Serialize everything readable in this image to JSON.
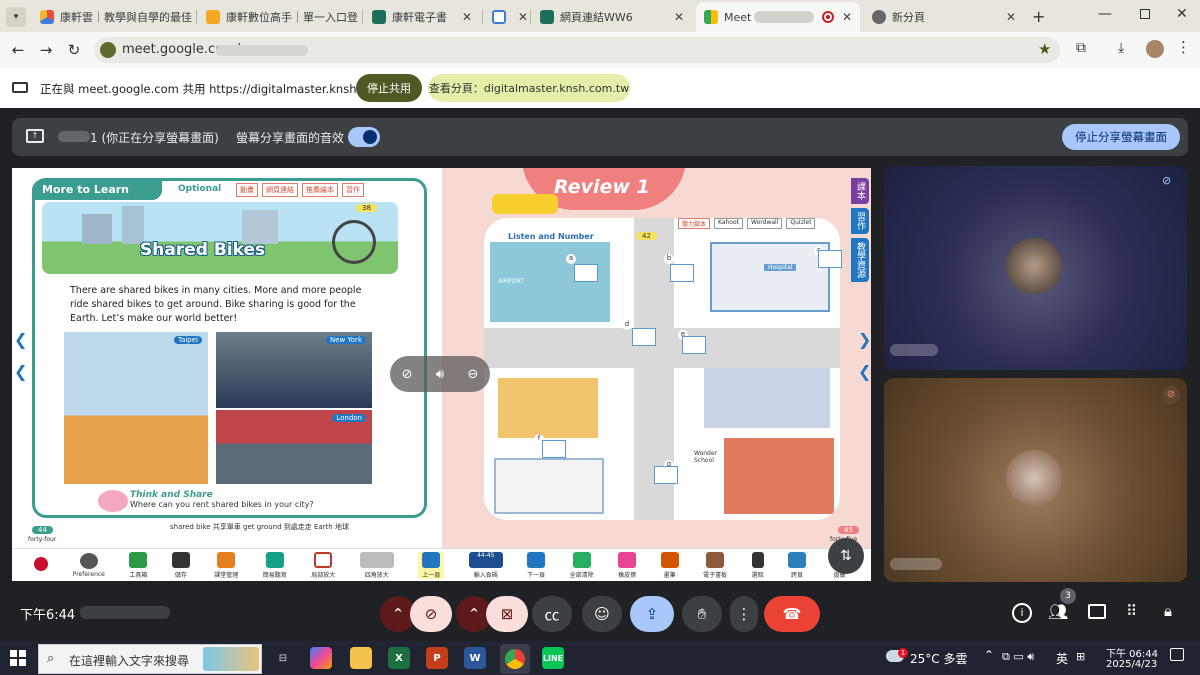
{
  "browser": {
    "tabs": [
      {
        "label": "康軒雲｜教學與自學的最佳"
      },
      {
        "label": "康軒數位高手｜單一入口登"
      },
      {
        "label": "康軒電子書"
      },
      {
        "label": ""
      },
      {
        "label": "網頁連結WW6"
      },
      {
        "label": "Meet -"
      },
      {
        "label": "新分頁"
      }
    ],
    "url": "meet.google.com/"
  },
  "sharebar": {
    "text": "正在與 meet.google.com 共用 https://digitalmaster.knsh.com.tw",
    "stop_label": "停止共用",
    "view_label": "查看分頁：digitalmaster.knsh.com.tw"
  },
  "meet_top": {
    "presenting_text": "1 (你正在分享螢幕畫面)",
    "audio_label": "螢幕分享畫面的音效",
    "stop_label": "停止分享螢幕畫面"
  },
  "book": {
    "more_title": "More to Learn",
    "optional": "Optional",
    "tags": [
      "動畫",
      "網頁連結",
      "推薦繪本",
      "習作"
    ],
    "page_ref": "38",
    "lesson_title": "Shared Bikes",
    "body": "There are shared bikes in many cities. More and more people ride shared bikes to get around.  Bike sharing is good for the Earth. Let’s make our world better!",
    "photos": [
      "Taipei",
      "New York",
      "London"
    ],
    "think_title": "Think and Share",
    "think_q": "Where can you rent shared bikes in your city?",
    "vocab": "shared bike 共享單車   get ground 到處走走   Earth 地球",
    "page_left": "44",
    "page_left_word": "forty-four",
    "review_title": "Review 1",
    "listen_label": "Listen and Number",
    "listen_ref": "42",
    "right_tags": [
      "聽力腳本",
      "Kahoot",
      "Wordwall",
      "Quizlet"
    ],
    "map_letters": [
      "a",
      "b",
      "c",
      "d",
      "e",
      "f",
      "g"
    ],
    "map_signs": [
      "AIRPORT",
      "Hospital",
      "Wonder School"
    ],
    "page_right": "45",
    "page_right_word": "forty-five",
    "side_tabs": [
      "課本",
      "習作",
      "教學資源"
    ],
    "toolbar": [
      "Preference",
      "工具箱",
      "儲存",
      "課堂管理",
      "簡易聽寫",
      "局部放大",
      "四角放大",
      "上一頁",
      "輸入頁碼",
      "下一頁",
      "全部清除",
      "橡皮擦",
      "畫筆",
      "電子書板",
      "選取",
      "跨頁",
      "頁籤"
    ],
    "page_input": "44-45"
  },
  "meet_bottom": {
    "time": "下午6:44",
    "people_count": "3"
  },
  "taskbar": {
    "search_placeholder": "在這裡輸入文字來搜尋",
    "weather": "25°C 多雲",
    "weather_badge": "1",
    "lang": "英",
    "time": "下午 06:44",
    "date": "2025/4/23"
  },
  "colors": {
    "accent_blue": "#a8c7fa",
    "end_call": "#ea4335",
    "muted_red": "#f9dedc",
    "book_green": "#3a9d8f",
    "review_pink": "#f08080",
    "stop_share_green": "#d9e8a8"
  }
}
